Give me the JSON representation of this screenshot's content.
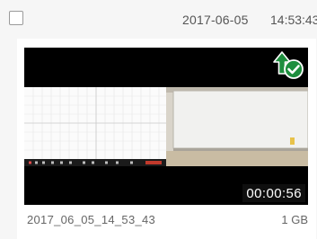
{
  "header": {
    "date": "2017-06-05",
    "time": "14:53:43"
  },
  "recording": {
    "duration": "00:00:56",
    "filename": "2017_06_05_14_53_43",
    "size": "1 GB",
    "status_icon": "upload-check-icon",
    "status_color": "#1e8e3e"
  }
}
